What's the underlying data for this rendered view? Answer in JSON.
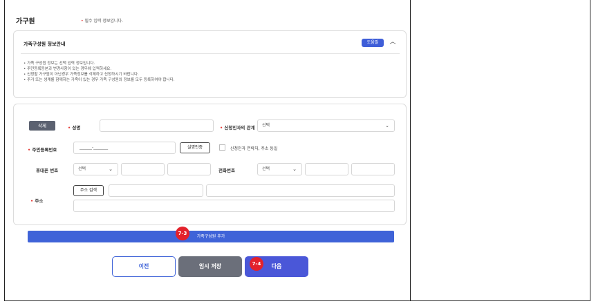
{
  "section": {
    "title": "가구원",
    "required_note": "필수 입력 정보입니다."
  },
  "info": {
    "title": "가족구성원 정보안내",
    "help_label": "도움말",
    "items": [
      "• 가족 구성원 정보는 선택 입력 정보입니다.",
      "• 주민등록등본과 변경사항이 있는 경우에 입력하세요.",
      "• 신청할 가구원이 아닌경우 가족정보를 삭제하고 신청하시기 바랍니다.",
      "• 주거 또는 생계를 함께하는 가족이 있는 경우 가족 구성원의 정보를 모두 등록하여야 합니다."
    ]
  },
  "form": {
    "delete_label": "삭제",
    "name_label": "성명",
    "relation_label": "신청인과의 관계",
    "relation_value": "선택",
    "rrn_label": "주민등록번호",
    "rrn_value": "______-_______",
    "verify_label": "실명인증",
    "same_as_applicant_label": "신청인과 연락처, 주소 동일",
    "mobile_label": "휴대폰 번호",
    "mobile_select": "선택",
    "phone_label": "전화번호",
    "phone_select": "선택",
    "address_label": "주소",
    "address_search_label": "주소 검색"
  },
  "add_member_label": "가족구성원 추가",
  "badges": {
    "add": "7-3",
    "next": "7-4"
  },
  "nav": {
    "prev": "이전",
    "save": "임시 저장",
    "next": "다음"
  },
  "colors": {
    "accent": "#3f63d8",
    "badge": "#e3212b",
    "required": "#e53935"
  }
}
